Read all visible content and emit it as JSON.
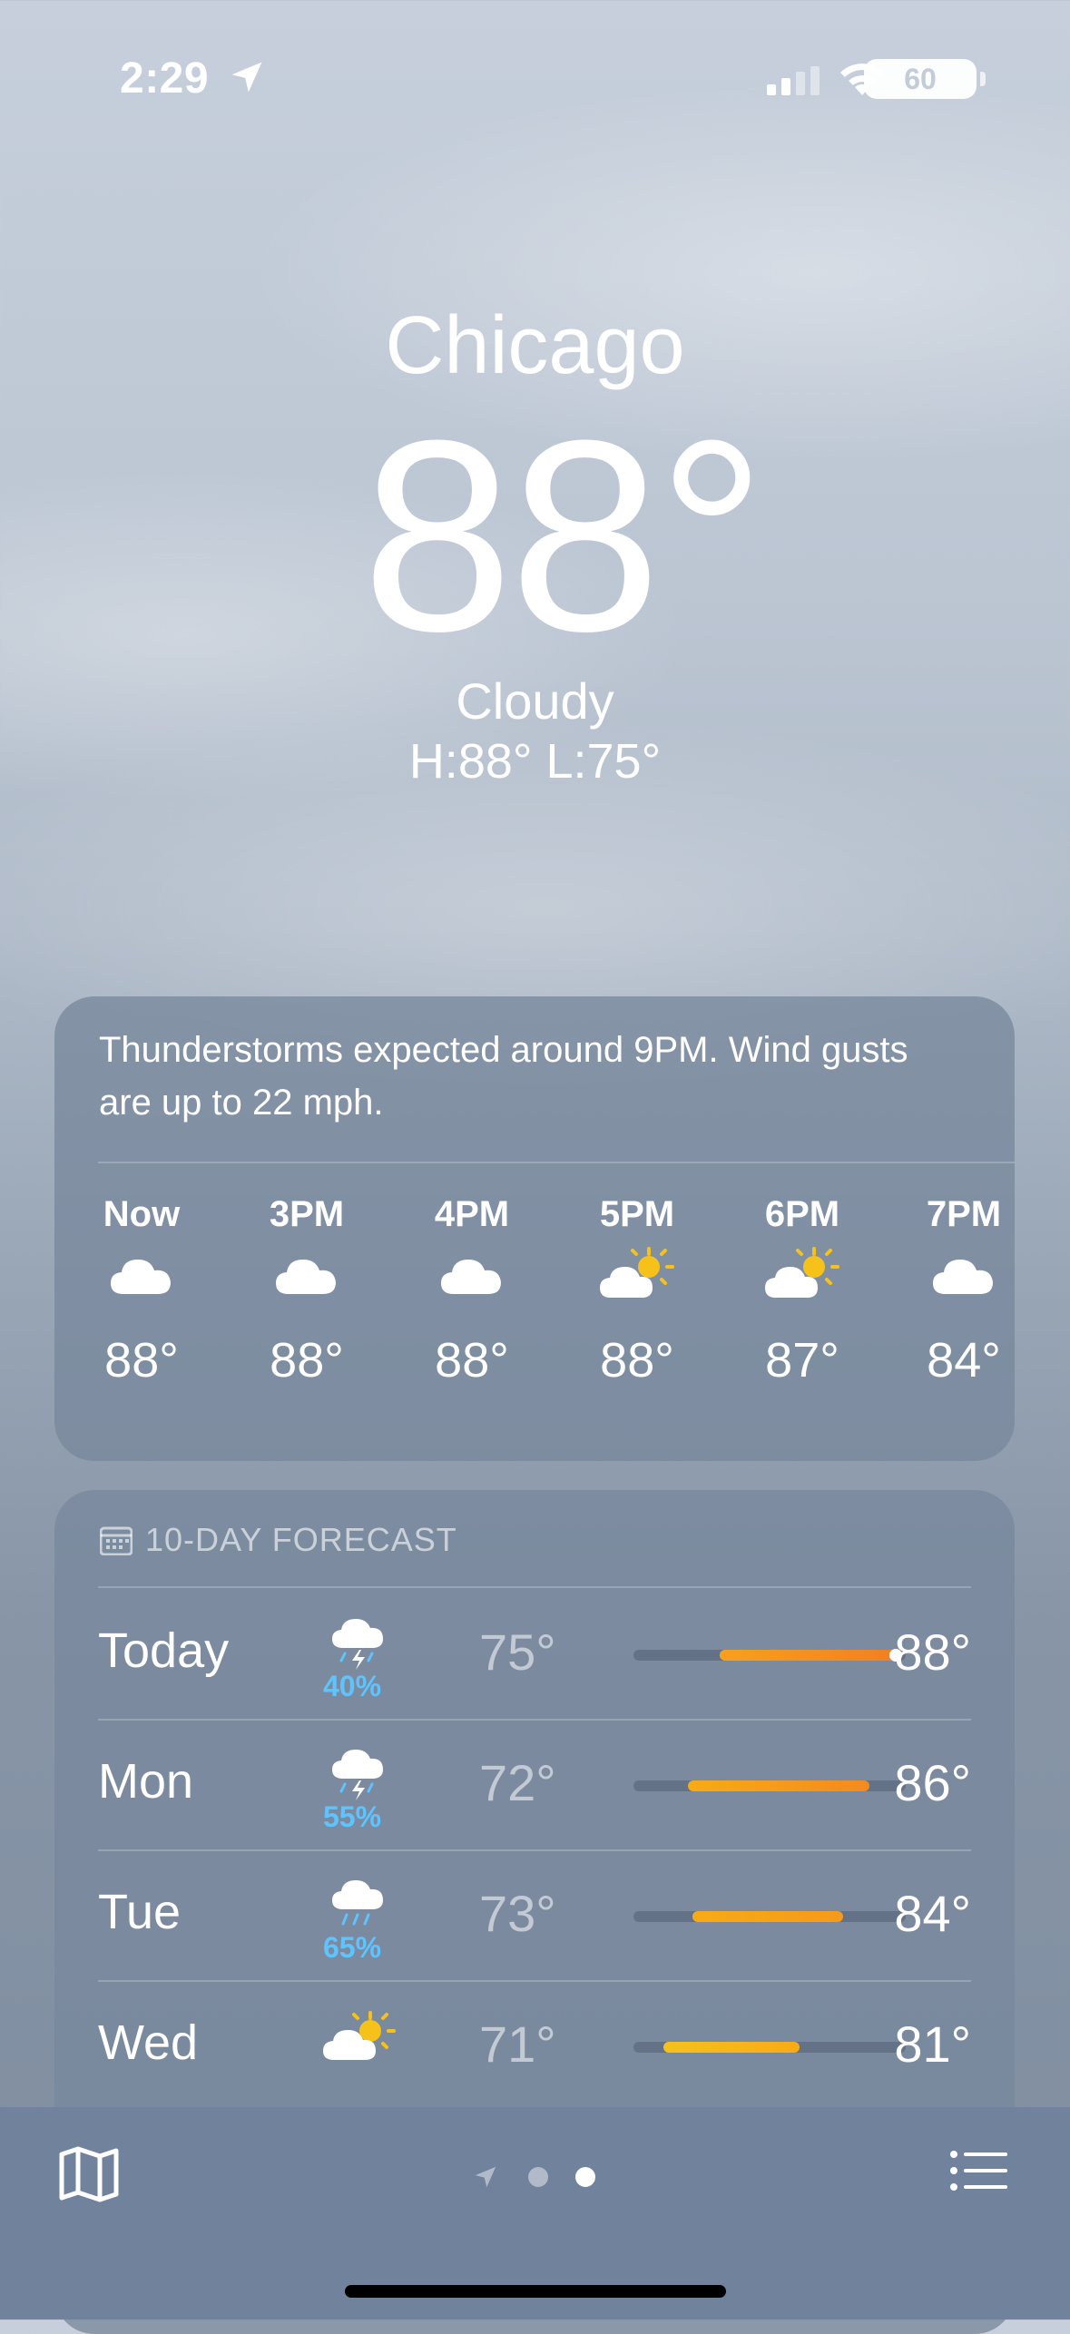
{
  "status_bar": {
    "time": "2:29",
    "battery": "60",
    "icons": [
      "location-arrow-icon",
      "cellular-signal-icon",
      "wifi-icon",
      "battery-icon"
    ]
  },
  "hero": {
    "city": "Chicago",
    "temperature": "88°",
    "condition": "Cloudy",
    "high_low": "H:88°  L:75°"
  },
  "hourly": {
    "summary": "Thunderstorms expected around 9PM. Wind gusts are up to 22 mph.",
    "hours": [
      {
        "label": "Now",
        "icon": "cloud-icon",
        "temp": "88°"
      },
      {
        "label": "3PM",
        "icon": "cloud-icon",
        "temp": "88°"
      },
      {
        "label": "4PM",
        "icon": "cloud-icon",
        "temp": "88°"
      },
      {
        "label": "5PM",
        "icon": "partly-sunny-icon",
        "temp": "88°"
      },
      {
        "label": "6PM",
        "icon": "partly-sunny-icon",
        "temp": "87°"
      },
      {
        "label": "7PM",
        "icon": "cloud-icon",
        "temp": "84°"
      }
    ]
  },
  "forecast": {
    "title": "10-DAY FORECAST",
    "days": [
      {
        "day": "Today",
        "icon": "thunderstorm-icon",
        "precip": "40%",
        "low": "75°",
        "high": "88°"
      },
      {
        "day": "Mon",
        "icon": "thunderstorm-icon",
        "precip": "55%",
        "low": "72°",
        "high": "86°"
      },
      {
        "day": "Tue",
        "icon": "rain-icon",
        "precip": "65%",
        "low": "73°",
        "high": "84°"
      },
      {
        "day": "Wed",
        "icon": "partly-sunny-icon",
        "precip": "",
        "low": "71°",
        "high": "81°"
      }
    ],
    "colors": {
      "warm_orange": "#f5931e",
      "amber": "#f7ab16",
      "yellow": "#f6c21a"
    }
  },
  "bottom_bar": {
    "icons": [
      "map-icon",
      "location-page-indicator-icon",
      "page-dot-icon",
      "list-icon"
    ]
  }
}
